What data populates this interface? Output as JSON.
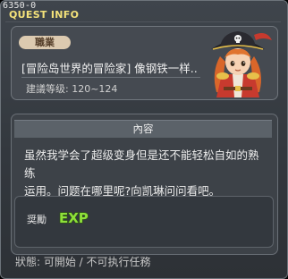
{
  "window": {
    "quest_id": "6350-0",
    "title": "QUEST INFO"
  },
  "quest": {
    "job_label": "職業",
    "name": "[冒险岛世界的冒险家] 像钢铁一样..",
    "level_text": "建議等级: 120~124",
    "npc_icon": "pirate-captain-npc-portrait"
  },
  "content": {
    "header": "內容",
    "lines": [
      "虽然我学会了超级变身但是还不能轻松自如的熟练",
      "运用。问题在哪里呢?向凯琳问问看吧。"
    ]
  },
  "reward": {
    "label": "奨勵",
    "items": [
      {
        "icon": "exp-icon",
        "text": "EXP"
      }
    ]
  },
  "status": {
    "text": "狀態: 可開始 / 不可执行任務"
  },
  "colors": {
    "title": "#f4e27a",
    "exp_green": "#8ee03a",
    "badge": "#dccab0",
    "panel": "#454a51"
  }
}
